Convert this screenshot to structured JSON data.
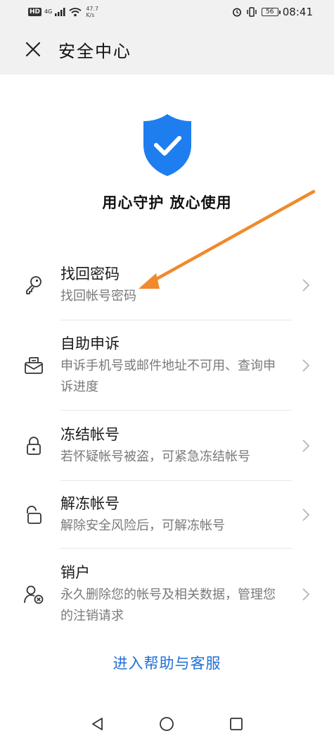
{
  "status_bar": {
    "badge": "HD",
    "network": "4G",
    "speed_value": "47.7",
    "speed_unit": "K/s",
    "battery": "56",
    "time": "08:41"
  },
  "header": {
    "title": "安全中心",
    "close_icon": "close-icon"
  },
  "hero": {
    "shield_color": "#1e7ef0",
    "slogan": "用心守护   放心使用"
  },
  "items": [
    {
      "title": "找回密码",
      "desc": "找回帐号密码",
      "icon": "key-icon"
    },
    {
      "title": "自助申诉",
      "desc": "申诉手机号或邮件地址不可用、查询申诉进度",
      "icon": "appeal-envelope-icon"
    },
    {
      "title": "冻结帐号",
      "desc": "若怀疑帐号被盗，可紧急冻结帐号",
      "icon": "lock-icon"
    },
    {
      "title": "解冻帐号",
      "desc": "解除安全风险后，可解冻帐号",
      "icon": "unlock-icon"
    },
    {
      "title": "销户",
      "desc": "永久删除您的帐号及相关数据，管理您的注销请求",
      "icon": "user-delete-icon"
    }
  ],
  "help_link": "进入帮助与客服",
  "colors": {
    "accent": "#1f6fd6",
    "annotation_arrow": "#f08a2c"
  }
}
